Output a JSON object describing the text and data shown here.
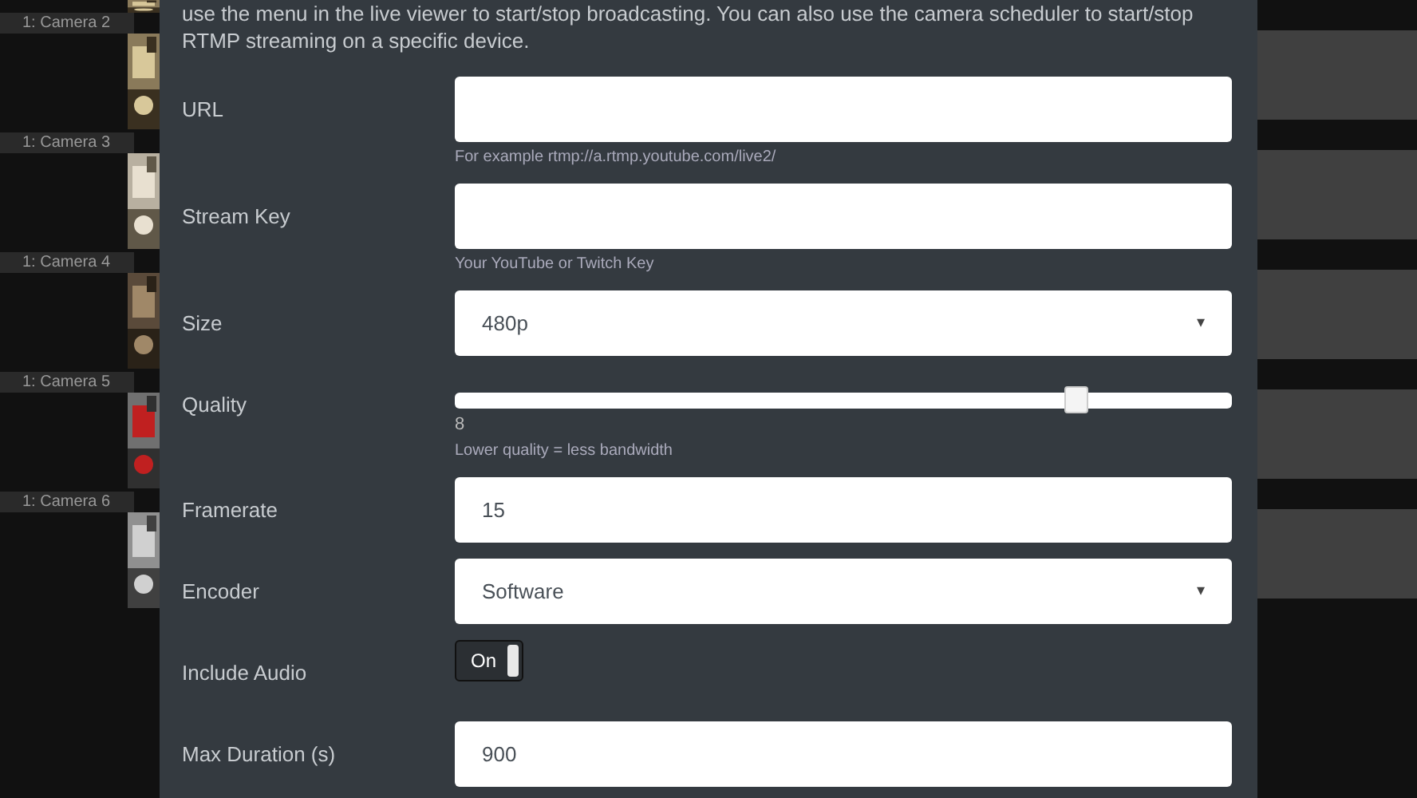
{
  "cameras": [
    {
      "label": "1: Camera 2"
    },
    {
      "label": "1: Camera 3"
    },
    {
      "label": "1: Camera 4"
    },
    {
      "label": "1: Camera 5"
    },
    {
      "label": "1: Camera 6"
    }
  ],
  "dialog": {
    "intro": "use the menu in the live viewer to start/stop broadcasting. You can also use the camera scheduler to start/stop RTMP streaming on a specific device.",
    "fields": [
      {
        "kind": "text",
        "label": "URL",
        "help": "For example rtmp://a.rtmp.youtube.com/live2/"
      },
      {
        "kind": "text",
        "label": "Stream Key",
        "help": "Your YouTube or Twitch Key"
      },
      {
        "kind": "select",
        "label": "Size",
        "value": "480p",
        "caret": "▾"
      },
      {
        "kind": "slider",
        "label": "Quality",
        "level": 0.8,
        "reading": "8",
        "help": "Lower quality = less bandwidth"
      },
      {
        "kind": "text",
        "label": "Framerate",
        "value": "15"
      },
      {
        "kind": "select",
        "label": "Encoder",
        "value": "Software",
        "caret": "▾"
      },
      {
        "kind": "toggle",
        "label": "Include Audio",
        "on": true,
        "text": "On"
      },
      {
        "kind": "text",
        "label": "Max Duration (s)",
        "value": "900"
      }
    ]
  }
}
